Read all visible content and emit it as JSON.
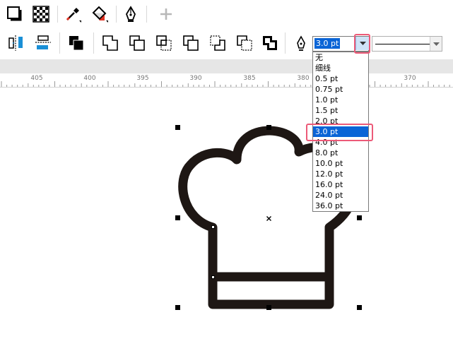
{
  "toolbar_top": {
    "icons": [
      "shadow-square-icon",
      "transparency-checker-icon",
      "eyedropper-icon",
      "fill-bucket-icon",
      "pen-nib-icon",
      "add-icon"
    ]
  },
  "toolbar_shape": {
    "icons": [
      "align-vertical-icon",
      "align-horizontal-icon",
      "combine-icon",
      "weld-icon",
      "trim-icon",
      "intersect-icon",
      "simplify-icon",
      "front-minus-back-icon",
      "back-minus-front-icon",
      "boundary-icon",
      "outline-pen-icon"
    ]
  },
  "outline_width": {
    "selected": "3.0 pt",
    "options": [
      "无",
      "细线",
      "0.5 pt",
      "0.75 pt",
      "1.0 pt",
      "1.5 pt",
      "2.0 pt",
      "3.0 pt",
      "4.0 pt",
      "8.0 pt",
      "10.0 pt",
      "12.0 pt",
      "16.0 pt",
      "24.0 pt",
      "36.0 pt"
    ]
  },
  "ruler": {
    "labels": [
      "405",
      "400",
      "395",
      "390",
      "385",
      "380",
      "370"
    ]
  },
  "colors": {
    "highlight": "#ec5a78",
    "selection": "#0a64d6",
    "shape_stroke": "#1e1714"
  }
}
